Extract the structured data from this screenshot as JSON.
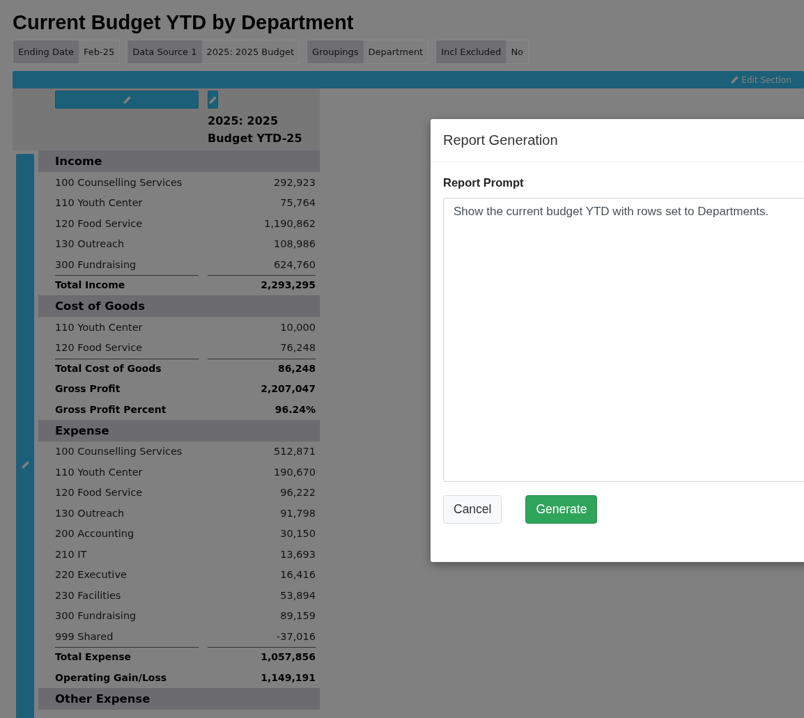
{
  "title": "Current Budget YTD by Department",
  "filters": [
    {
      "label": "Ending Date",
      "value": "Feb-25"
    },
    {
      "label": "Data Source 1",
      "value": "2025: 2025 Budget"
    },
    {
      "label": "Groupings",
      "value": "Department"
    },
    {
      "label": "Incl Excluded",
      "value": "No"
    }
  ],
  "section_bar": {
    "action": "Edit Section"
  },
  "table": {
    "column_header": "2025: 2025 Budget YTD-25",
    "rows": [
      {
        "kind": "header",
        "label": "Income"
      },
      {
        "kind": "item",
        "label": "100 Counselling Services",
        "value": "292,923"
      },
      {
        "kind": "item",
        "label": "110 Youth Center",
        "value": "75,764"
      },
      {
        "kind": "item",
        "label": "120 Food Service",
        "value": "1,190,862"
      },
      {
        "kind": "item",
        "label": "130 Outreach",
        "value": "108,986"
      },
      {
        "kind": "item",
        "label": "300 Fundraising",
        "value": "624,760"
      },
      {
        "kind": "total",
        "label": "Total Income",
        "value": "2,293,295"
      },
      {
        "kind": "header",
        "label": "Cost of Goods"
      },
      {
        "kind": "item",
        "label": "110 Youth Center",
        "value": "10,000"
      },
      {
        "kind": "item",
        "label": "120 Food Service",
        "value": "76,248"
      },
      {
        "kind": "total",
        "label": "Total Cost of Goods",
        "value": "86,248"
      },
      {
        "kind": "summary",
        "label": "Gross Profit",
        "value": "2,207,047"
      },
      {
        "kind": "summary",
        "label": "Gross Profit Percent",
        "value": "96.24%"
      },
      {
        "kind": "header",
        "label": "Expense"
      },
      {
        "kind": "item",
        "label": "100 Counselling Services",
        "value": "512,871"
      },
      {
        "kind": "item",
        "label": "110 Youth Center",
        "value": "190,670"
      },
      {
        "kind": "item",
        "label": "120 Food Service",
        "value": "96,222"
      },
      {
        "kind": "item",
        "label": "130 Outreach",
        "value": "91,798"
      },
      {
        "kind": "item",
        "label": "200 Accounting",
        "value": "30,150"
      },
      {
        "kind": "item",
        "label": "210 IT",
        "value": "13,693"
      },
      {
        "kind": "item",
        "label": "220 Executive",
        "value": "16,416"
      },
      {
        "kind": "item",
        "label": "230 Facilities",
        "value": "53,894"
      },
      {
        "kind": "item",
        "label": "300 Fundraising",
        "value": "89,159"
      },
      {
        "kind": "item",
        "label": "999 Shared",
        "value": "-37,016"
      },
      {
        "kind": "total",
        "label": "Total Expense",
        "value": "1,057,856"
      },
      {
        "kind": "summary",
        "label": "Operating Gain/Loss",
        "value": "1,149,191"
      },
      {
        "kind": "header",
        "label": "Other Expense"
      }
    ]
  },
  "dialog": {
    "title": "Report Generation",
    "field_label": "Report Prompt",
    "prompt": "Show the current budget YTD with rows set to Departments.",
    "buttons": [
      {
        "label": "Cancel",
        "kind": "secondary"
      },
      {
        "label": "Generate",
        "kind": "primary"
      }
    ]
  }
}
